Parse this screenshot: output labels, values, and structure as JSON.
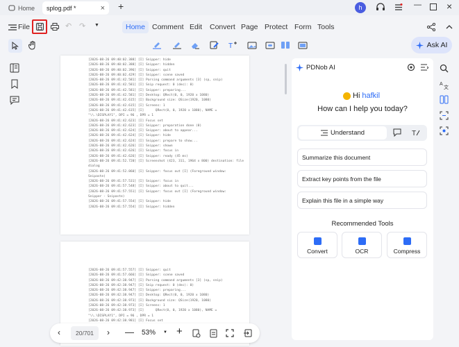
{
  "titlebar": {
    "home_tab": "Home",
    "doc_tab": "splog.pdf *",
    "avatar_letter": "h"
  },
  "menu": {
    "file": "File",
    "items": [
      "Home",
      "Comment",
      "Edit",
      "Convert",
      "Page",
      "Protect",
      "Form",
      "Tools"
    ],
    "active": "Home",
    "ask_ai": "Ask AI"
  },
  "page1_log": [
    "[2026-08-26 09:40:02.388] [I] Snipper: hide",
    "[2026-08-26 09:40:02.388] [I] Snipper: hidden",
    "[2026-08-26 09:40:02.396] [I] Snipper: quit",
    "[2026-08-26 09:40:02.429] [I] Snipper: scene saved",
    "[2026-08-26 09:41:42.581] [I] Parsing command arguments [3] (sp, snip)",
    "[2026-08-26 09:41:42.581] [I] Snip request: 0 (dec): 0)",
    "[2026-08-26 09:41:42.581] [I] Snipper: preparing...",
    "[2026-08-26 09:41:42.581] [I] Desktop: QRect(0, 0, 1920 x 1080)",
    "[2026-08-26 09:41:42.615] [I] Background size: QSize(1920, 1080)",
    "[2026-08-26 09:41:42.615] [I] Screens: 1",
    "[2026-08-26 09:41:42.615] [I]      QRect(0, 0, 1920 x 1080), NAME =",
    "\"\\\\.\\DISPLAY1\", DPI = 96 , DPR = 1",
    "[2026-08-26 09:41:42.623] [I] Focus set",
    "[2026-08-26 09:41:42.623] [I] Snipper: preparation done (0)",
    "[2026-08-26 09:41:42.624] [I] Snipper: about to appear...",
    "[2026-08-26 09:41:42.624] [I] Snipper: hide",
    "[2026-08-26 09:41:42.624] [I] Snipper: prepare to show...",
    "[2026-08-26 09:41:42.626] [I] Snipper: shown",
    "[2026-08-26 09:41:42.626] [I] Snipper: focus in",
    "[2026-08-26 09:41:42.626] [I] Snipper: ready (45 ms)",
    "[2026-08-26 09:41:52.720] [I] Screenshot (423, 311, 1964 x 800) destination: file",
    "dialog",
    "[2026-08-26 09:41:52.860] [I] Snipper: focus out [I] (Foreground window:",
    "Snipaste)",
    "[2026-08-26 09:41:57.531] [I] Snipper: focus in",
    "[2026-08-26 09:41:57.548] [I] Snipper: about to quit...",
    "[2026-08-26 09:41:57.551] [I] Snipper: focus out [I] (Foreground window:",
    "Snipper - Snipaste)",
    "[2026-08-26 09:41:57.554] [I] Snipper: hide",
    "[2026-08-26 09:41:57.554] [I] Snipper: hidden"
  ],
  "page2_log": [
    "[2026-08-26 09:41:57.557] [I] Snipper: quit",
    "[2026-08-26 09:41:57.666] [I] Snipper: scene saved",
    "[2026-08-26 09:42:38.947] [I] Parsing command arguments [3] (sp, snip)",
    "[2026-08-26 09:42:38.947] [I] Snip request: 0 (dec): 0)",
    "[2026-08-26 09:42:38.947] [I] Snipper: preparing...",
    "[2026-08-26 09:42:38.947] [I] Desktop: QRect(0, 0, 1920 x 1080)",
    "[2026-08-26 09:42:38.973] [I] Background size: QSize(1920, 1080)",
    "[2026-08-26 09:42:38.973] [I] Screens: 1",
    "[2026-08-26 09:42:38.973] [I]      QRect(0, 0, 1920 x 1080), NAME =",
    "\"\\\\.\\DISPLAY1\", DPI = 96 , DPR = 1",
    "[2026-08-26 09:42:38.981] [I] Focus set"
  ],
  "bottombar": {
    "page_indicator": "20/701",
    "zoom": "53%"
  },
  "ai": {
    "title": "PDNob AI",
    "greeting_prefix": "Hi ",
    "username": "hafkil",
    "question": "How can I help you today?",
    "understand": "Understand",
    "suggestions": [
      "Summarize this document",
      "Extract key points from the file",
      "Explain this file in a simple way"
    ],
    "recommended_title": "Recommended Tools",
    "tools": [
      "Convert",
      "OCR",
      "Compress"
    ]
  },
  "colors": {
    "accent": "#2d6cf6",
    "highlight_border": "#e02020",
    "active_tab_bg": "#e4eaf8"
  }
}
